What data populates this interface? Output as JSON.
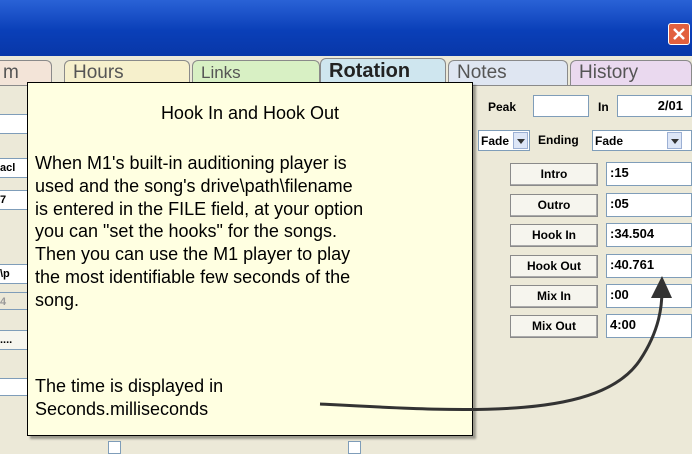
{
  "window": {
    "close_icon": "close-x-icon",
    "close_color": "#e2603e"
  },
  "tabs": [
    {
      "label": "m"
    },
    {
      "label": "Hours"
    },
    {
      "label": "Links"
    },
    {
      "label": "Rotation"
    },
    {
      "label": "Notes"
    },
    {
      "label": "History"
    }
  ],
  "form": {
    "peak_label": "Peak",
    "peak_value": "",
    "in_label": "In",
    "in_value": "2/01",
    "fade_value": "Fade",
    "ending_label": "Ending",
    "ending_value": "Fade",
    "intro_label": "Intro",
    "intro_value": ":15",
    "outro_label": "Outro",
    "outro_value": ":05",
    "hook_in_label": "Hook In",
    "hook_in_value": ":34.504",
    "hook_out_label": "Hook Out",
    "hook_out_value": ":40.761",
    "mix_in_label": "Mix In",
    "mix_in_value": ":00",
    "mix_out_label": "Mix Out",
    "mix_out_value": "4:00"
  },
  "left_fields": [
    "acl",
    "7",
    "\\p",
    "4",
    "...."
  ],
  "tooltip": {
    "title": "Hook In and Hook Out",
    "body": "When M1's built-in auditioning player is\nused and the song's drive\\path\\filename\nis entered in the FILE field, at your option\nyou can \"set the hooks\" for the songs.\nThen you can use the M1 player to play\nthe most identifiable few seconds of the\nsong.",
    "footer": "The time is displayed in\nSeconds.milliseconds"
  }
}
